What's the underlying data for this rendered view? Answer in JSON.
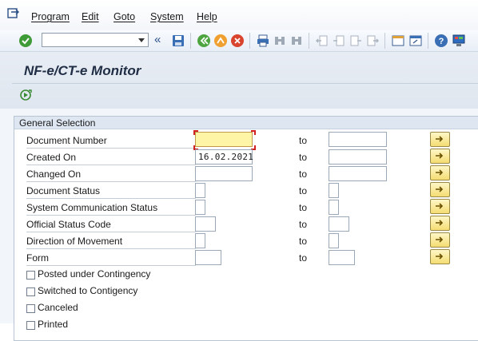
{
  "menu": {
    "items": [
      "Program",
      "Edit",
      "Goto",
      "System",
      "Help"
    ]
  },
  "toolbar": {
    "command_field_value": "",
    "icons": [
      "enter-icon",
      "command-dropdown-icon",
      "collapse-icon",
      "save-icon",
      "back-icon",
      "exit-icon",
      "cancel-icon",
      "print-icon",
      "find-icon",
      "find-next-icon",
      "first-page-icon",
      "previous-page-icon",
      "next-page-icon",
      "last-page-icon",
      "create-session-icon",
      "shortcut-icon",
      "help-icon",
      "customize-layout-icon"
    ]
  },
  "page": {
    "title": "NF-e/CT-e Monitor"
  },
  "selection": {
    "group_title": "General Selection",
    "to_label": "to",
    "fields": [
      {
        "label": "Document Number",
        "from": "",
        "to": ""
      },
      {
        "label": "Created On",
        "from": "16.02.2021",
        "to": ""
      },
      {
        "label": "Changed On",
        "from": "",
        "to": ""
      },
      {
        "label": "Document Status",
        "from": "",
        "to": ""
      },
      {
        "label": "System Communication Status",
        "from": "",
        "to": ""
      },
      {
        "label": "Official Status Code",
        "from": "",
        "to": ""
      },
      {
        "label": "Direction of Movement",
        "from": "",
        "to": ""
      },
      {
        "label": "Form",
        "from": "",
        "to": ""
      }
    ],
    "checkboxes": [
      {
        "label": "Posted under Contingency",
        "checked": false
      },
      {
        "label": "Switched to Contigency",
        "checked": false
      },
      {
        "label": "Canceled",
        "checked": false
      },
      {
        "label": "Printed",
        "checked": false
      }
    ]
  },
  "colors": {
    "active_field": "#fff5a6",
    "arrow_button": "#f4dd73",
    "title_bg": "#e8edf4"
  }
}
